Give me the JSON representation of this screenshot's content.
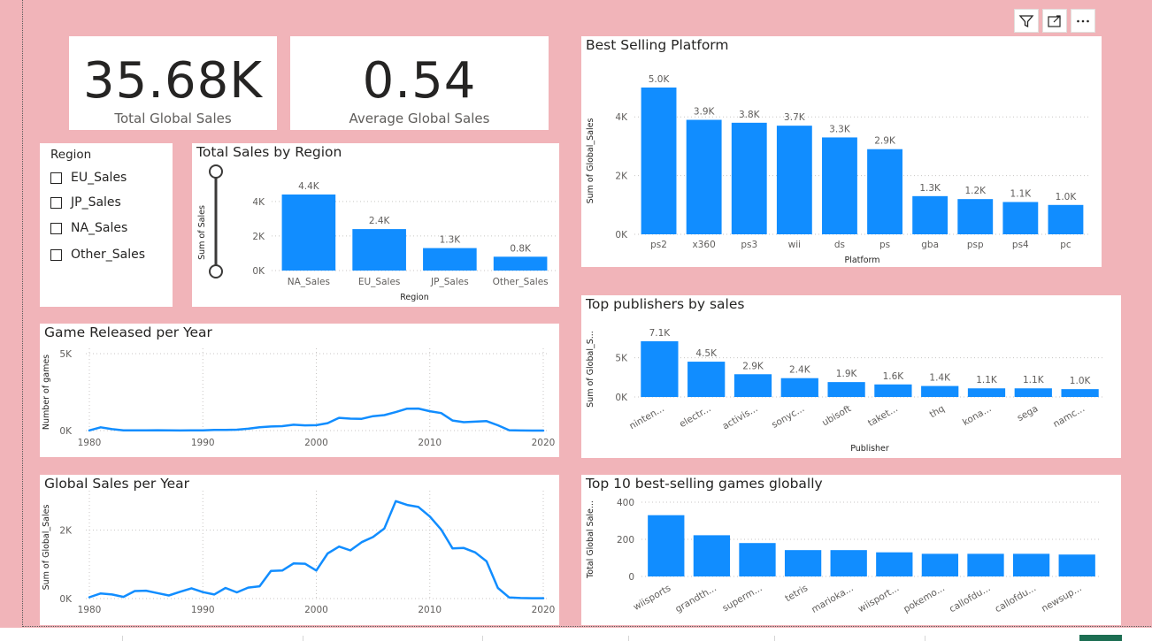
{
  "kpis": {
    "total": {
      "value": "35.68K",
      "label": "Total Global Sales"
    },
    "average": {
      "value": "0.54",
      "label": "Average Global Sales"
    }
  },
  "slicer": {
    "title": "Region",
    "items": [
      "EU_Sales",
      "JP_Sales",
      "NA_Sales",
      "Other_Sales"
    ]
  },
  "toolbar": {
    "icons": [
      "filter-icon",
      "focus-mode-icon",
      "more-options-icon"
    ]
  },
  "colors": {
    "bar": "#118dff",
    "line": "#118dff",
    "background": "#f1b4b9",
    "card": "#ffffff"
  },
  "chart_data": [
    {
      "id": "region",
      "type": "bar",
      "title": "Total Sales by Region",
      "xlabel": "Region",
      "ylabel": "Sum of Sales",
      "categories": [
        "NA_Sales",
        "EU_Sales",
        "JP_Sales",
        "Other_Sales"
      ],
      "values": [
        4.4,
        2.4,
        1.3,
        0.8
      ],
      "value_labels": [
        "4.4K",
        "2.4K",
        "1.3K",
        "0.8K"
      ],
      "ylim": [
        0,
        4.4
      ],
      "yticks": [
        0,
        2,
        4
      ],
      "ytick_labels": [
        "0K",
        "2K",
        "4K"
      ],
      "grid": true
    },
    {
      "id": "platform",
      "type": "bar",
      "title": "Best Selling Platform",
      "xlabel": "Platform",
      "ylabel": "Sum of Global_Sales",
      "categories": [
        "ps2",
        "x360",
        "ps3",
        "wii",
        "ds",
        "ps",
        "gba",
        "psp",
        "ps4",
        "pc"
      ],
      "values": [
        5.0,
        3.9,
        3.8,
        3.7,
        3.3,
        2.9,
        1.3,
        1.2,
        1.1,
        1.0
      ],
      "value_labels": [
        "5.0K",
        "3.9K",
        "3.8K",
        "3.7K",
        "3.3K",
        "2.9K",
        "1.3K",
        "1.2K",
        "1.1K",
        "1.0K"
      ],
      "ylim": [
        0,
        5.0
      ],
      "yticks": [
        0,
        2,
        4
      ],
      "ytick_labels": [
        "0K",
        "2K",
        "4K"
      ],
      "grid": true
    },
    {
      "id": "publishers",
      "type": "bar",
      "title": "Top publishers by sales",
      "xlabel": "Publisher",
      "ylabel": "Sum of Global_S...",
      "categories": [
        "ninten...",
        "electr...",
        "activis...",
        "sonyc...",
        "ubisoft",
        "taket...",
        "thq",
        "kona...",
        "sega",
        "namc..."
      ],
      "values": [
        7.1,
        4.5,
        2.9,
        2.4,
        1.9,
        1.6,
        1.4,
        1.1,
        1.1,
        1.0
      ],
      "value_labels": [
        "7.1K",
        "4.5K",
        "2.9K",
        "2.4K",
        "1.9K",
        "1.6K",
        "1.4K",
        "1.1K",
        "1.1K",
        "1.0K"
      ],
      "ylim": [
        0,
        7.1
      ],
      "yticks": [
        0,
        5
      ],
      "ytick_labels": [
        "0K",
        "5K"
      ],
      "grid": true
    },
    {
      "id": "games_year",
      "type": "line",
      "title": "Game Released per Year",
      "ylabel": "Number of games",
      "x": [
        1980,
        1981,
        1982,
        1983,
        1984,
        1985,
        1986,
        1987,
        1988,
        1989,
        1990,
        1991,
        1992,
        1993,
        1994,
        1995,
        1996,
        1997,
        1998,
        1999,
        2000,
        2001,
        2002,
        2003,
        2004,
        2005,
        2006,
        2007,
        2008,
        2009,
        2010,
        2011,
        2012,
        2013,
        2014,
        2015,
        2016,
        2017,
        2018,
        2019,
        2020
      ],
      "values": [
        9,
        210,
        90,
        17,
        14,
        14,
        21,
        16,
        6,
        17,
        16,
        41,
        43,
        60,
        121,
        219,
        263,
        289,
        379,
        338,
        349,
        482,
        829,
        775,
        762,
        939,
        1006,
        1202,
        1428,
        1431,
        1257,
        1139,
        657,
        546,
        582,
        614,
        344,
        23,
        5,
        0,
        1
      ],
      "xticks": [
        1980,
        1990,
        2000,
        2010,
        2020
      ],
      "yticks": [
        0,
        5000
      ],
      "ytick_labels": [
        "0K",
        "5K"
      ],
      "xlim": [
        1980,
        2020
      ],
      "ylim": [
        0,
        5000
      ],
      "grid": true
    },
    {
      "id": "sales_year",
      "type": "line",
      "title": "Global Sales per Year",
      "ylabel": "Sum of Global_Sales",
      "x": [
        1980,
        1981,
        1982,
        1983,
        1984,
        1985,
        1986,
        1987,
        1988,
        1989,
        1990,
        1991,
        1992,
        1993,
        1994,
        1995,
        1996,
        1997,
        1998,
        1999,
        2000,
        2001,
        2002,
        2003,
        2004,
        2005,
        2006,
        2007,
        2008,
        2009,
        2010,
        2011,
        2012,
        2013,
        2014,
        2015,
        2016,
        2017,
        2018,
        2019,
        2020
      ],
      "values": [
        40,
        150,
        120,
        50,
        220,
        230,
        160,
        90,
        200,
        300,
        190,
        120,
        310,
        180,
        320,
        360,
        810,
        820,
        1030,
        1020,
        820,
        1320,
        1520,
        1410,
        1650,
        1800,
        2050,
        2850,
        2740,
        2680,
        2400,
        2020,
        1470,
        1480,
        1350,
        1090,
        310,
        30,
        15,
        10,
        10
      ],
      "xticks": [
        1980,
        1990,
        2000,
        2010,
        2020
      ],
      "yticks": [
        0,
        2000
      ],
      "ytick_labels": [
        "0K",
        "2K"
      ],
      "xlim": [
        1980,
        2020
      ],
      "ylim": [
        0,
        3000
      ],
      "grid": true
    },
    {
      "id": "top_games",
      "type": "bar",
      "title": "Top 10 best-selling games globally",
      "ylabel": "Total Global Sale...",
      "categories": [
        "wiisports",
        "grandth...",
        "superm...",
        "tetris",
        "marioka...",
        "wiisport...",
        "pokemo...",
        "callofdu...",
        "callofdu...",
        "newsup..."
      ],
      "values": [
        330,
        222,
        180,
        142,
        142,
        130,
        122,
        122,
        122,
        118
      ],
      "ylim": [
        0,
        400
      ],
      "yticks": [
        0,
        200,
        400
      ],
      "ytick_labels": [
        "0",
        "200",
        "400"
      ],
      "grid": true
    }
  ]
}
